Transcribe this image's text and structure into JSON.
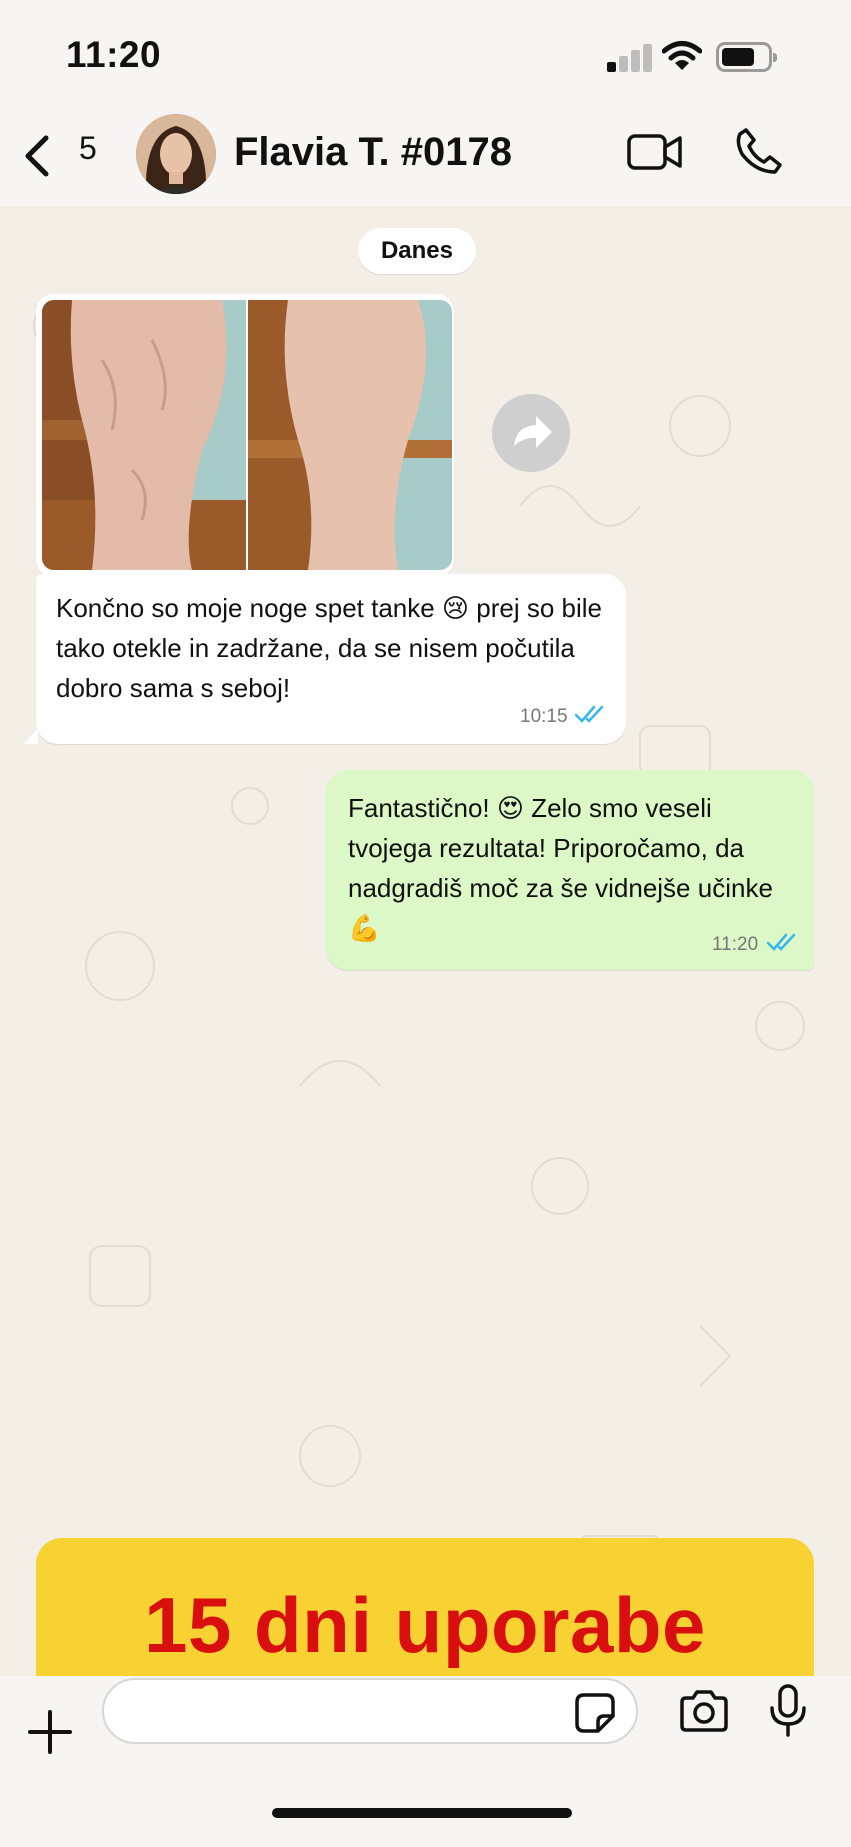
{
  "status_bar": {
    "time": "11:20",
    "icons": [
      "signal-icon",
      "wifi-icon",
      "battery-icon"
    ]
  },
  "header": {
    "back_icon": "chevron-left-icon",
    "unread_count": "5",
    "contact_name": "Flavia T. #0178",
    "video_icon": "video-camera-icon",
    "call_icon": "phone-icon"
  },
  "chat": {
    "date_label": "Danes",
    "messages": [
      {
        "direction": "incoming",
        "has_images": true,
        "text": "Končno so moje noge spet tanke 😢 prej so bile tako otekle in zadržane, da se nisem počutila dobro sama s seboj!",
        "time": "10:15",
        "status_icon": "double-check-icon"
      },
      {
        "direction": "outgoing",
        "text": "Fantastično! 😍 Zelo smo veseli tvojega rezultata! Priporočamo, da nadgradiš moč za še vidnejše učinke 💪",
        "time": "11:20",
        "status_icon": "double-check-icon"
      }
    ]
  },
  "banner": {
    "text": "15 dni uporabe"
  },
  "input_bar": {
    "message_value": "",
    "message_placeholder": "",
    "icons": [
      "plus-icon",
      "sticker-icon",
      "camera-icon",
      "microphone-icon"
    ]
  },
  "colors": {
    "chat_background": "#f3efe6",
    "outgoing_bubble": "#dcf8c6",
    "banner_background": "#f8d232",
    "banner_text": "#d90f0f",
    "tick_blue": "#34b7f1"
  }
}
